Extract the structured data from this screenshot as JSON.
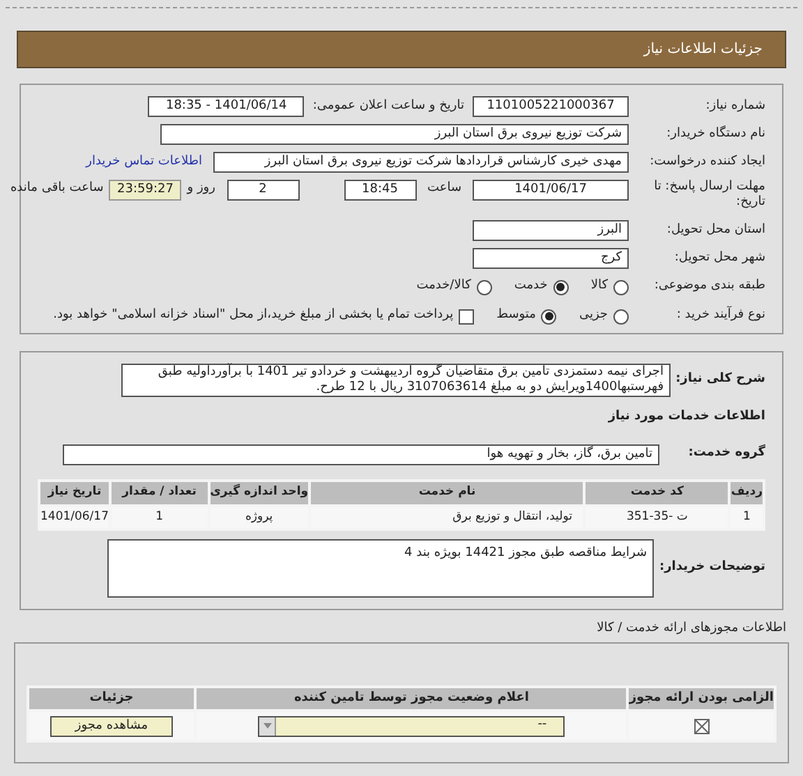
{
  "header": {
    "title": "جزئیات اطلاعات نیاز"
  },
  "details": {
    "need_number": {
      "label": "شماره نیاز:",
      "value": "1101005221000367"
    },
    "announce": {
      "label": "تاریخ و ساعت اعلان عمومی:",
      "value": "1401/06/14 - 18:35"
    },
    "buyer": {
      "label": "نام دستگاه خریدار:",
      "value": "شرکت توزیع نیروی برق استان البرز"
    },
    "creator": {
      "label": "ایجاد کننده درخواست:",
      "value": "مهدی خیری کارشناس قراردادها شرکت توزیع نیروی برق استان البرز",
      "link": "اطلاعات تماس خریدار"
    },
    "deadline": {
      "label": "مهلت ارسال پاسخ: تا تاریخ:",
      "date": "1401/06/17",
      "time_label": "ساعت",
      "time": "18:45",
      "days": "2",
      "days_label": "روز و",
      "remaining": "23:59:27",
      "remaining_label": "ساعت باقی مانده"
    },
    "province": {
      "label": "استان محل تحویل:",
      "value": "البرز"
    },
    "city": {
      "label": "شهر محل تحویل:",
      "value": "کرج"
    },
    "category": {
      "label": "طبقه بندی موضوعی:",
      "options": [
        {
          "label": "کالا",
          "selected": false
        },
        {
          "label": "خدمت",
          "selected": true
        },
        {
          "label": "کالا/خدمت",
          "selected": false
        }
      ]
    },
    "process": {
      "label": "نوع فرآیند خرید :",
      "options": [
        {
          "label": "جزیی",
          "selected": false
        },
        {
          "label": "متوسط",
          "selected": true
        }
      ],
      "payment": {
        "label": "پرداخت تمام یا بخشی از مبلغ خرید،از محل \"اسناد خزانه اسلامی\" خواهد بود.",
        "checked": false
      }
    }
  },
  "services": {
    "description": {
      "label": "شرح کلی نیاز:",
      "value": "اجرای نیمه دستمزدی تامین برق متقاضیان گروه اردیبهشت و خردادو تیر 1401 با برآورداولیه طبق فهرستبها1400ویرایش دو به مبلغ 3107063614 ریال با 12 طرح."
    },
    "heading": "اطلاعات خدمات مورد نیاز",
    "group": {
      "label": "گروه خدمت:",
      "value": "تامین برق، گاز، بخار و تهویه هوا"
    },
    "table": {
      "columns": [
        "ردیف",
        "کد خدمت",
        "نام خدمت",
        "واحد اندازه گیری",
        "تعداد / مقدار",
        "تاریخ نیاز"
      ],
      "rows": [
        [
          "1",
          "ت -35-351",
          "تولید، انتقال و توزیع برق",
          "پروژه",
          "1",
          "1401/06/17"
        ]
      ]
    },
    "notes": {
      "label": "توضیحات خریدار:",
      "value": "شرایط مناقصه طبق مجوز 14421 بویژه بند 4"
    }
  },
  "licenses": {
    "title": "اطلاعات مجوزهای ارائه خدمت / کالا",
    "columns": [
      "الزامی بودن ارائه مجوز",
      "اعلام وضعیت مجوز توسط تامین کننده",
      "جزئیات"
    ],
    "rows": [
      {
        "required": true,
        "status": "--",
        "button": "مشاهده مجوز"
      }
    ]
  }
}
